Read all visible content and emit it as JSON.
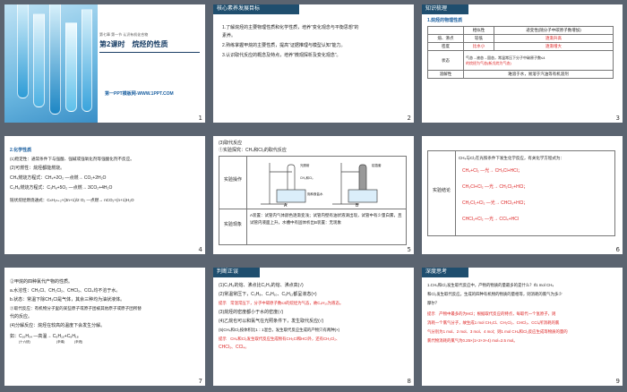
{
  "slide1": {
    "unit_label": "第七章 第一节 认识有机化合物",
    "title": "第2课时　烷烃的性质",
    "site": "第一PPT模板网-WWW.1PPT.COM",
    "page": "1"
  },
  "slide2": {
    "header": "核心素养发展目标",
    "items": [
      "1.了解烷烃的主要物理性质和化学性质，培养“变化观念与平衡思想”的",
      "素养。",
      "2.熟练掌握甲烷的主要性质，提高“证据推理与模型认知”能力。",
      "3.认识取代反应的概念及特点，培养“微观探析及变化观念”。"
    ],
    "page": "2"
  },
  "slide3": {
    "header": "知识梳理",
    "subtitle": "1.烷烃的物理性质",
    "col_header": "相似性",
    "col_trend": "递变性(随分子中碳原子数增加)",
    "rows": [
      [
        "熔、沸点",
        "较低",
        "逐渐升高"
      ],
      [
        "密度",
        "比水小",
        "逐渐增大"
      ],
      [
        "状态",
        "气态→液态→固态，常温常压下分子中碳原子数≤4",
        "的烷烃为气态(新戊烷为气态)"
      ],
      [
        "溶解性",
        "难溶于水，易溶于汽油等有机溶剂",
        ""
      ]
    ],
    "page": "3"
  },
  "slide4": {
    "heading": "2.化学性质",
    "lines": [
      "(1)稳定性：通常条件下与强酸、强碱或强氧化剂等强酸化剂不反应。",
      "(2)可燃性：烷烃都能燃烧。",
      "CH₄燃烧方程式：CH₄+2O₂ —点燃→ CO₂+2H₂O",
      "C₃H₈燃烧方程式：C₃H₈+5O₂ —点燃→ 3CO₂+4H₂O",
      "链状烷烃燃烧通式：CₙH₂ₙ₊₂+(3n+1)/2 O₂ —点燃→ nCO₂+(n+1)H₂O"
    ],
    "page": "4"
  },
  "slide5": {
    "heading": "(3)取代反应",
    "sub": "①实验探究：CH₄和Cl₂的取代反应",
    "row1_label": "实验操作",
    "row2_label": "实验现象",
    "lbl_a": "A",
    "lbl_b": "B",
    "diagram_labels": [
      "光照射",
      "铝箔套",
      "CH₄和Cl₂",
      "饱和食盐水"
    ],
    "result": "A装置：试管内气体颜色逐渐变浅；试管内壁有油状液滴出现，试管中有少量白雾，且试管内液面上升，水槽中有固体析出B装置：无现象",
    "page": "5"
  },
  "slide6": {
    "label": "实验结论",
    "intro": "CH₄与Cl₂在光照条件下发生化学反应，有关化学方程式为：",
    "eqs": [
      "CH₄+Cl₂ —光→ CH₃Cl+HCl；",
      "CH₃Cl+Cl₂ —光→ CH₂Cl₂+HCl；",
      "CH₂Cl₂+Cl₂ —光→ CHCl₃+HCl；",
      "CHCl₃+Cl₂ —光→ CCl₄+HCl"
    ],
    "page": "6"
  },
  "slide7": {
    "lines": [
      "②甲烷的四种氯代产物的性质。",
      "a.水溶性：CH₃Cl、CH₂Cl₂、CHCl₃、CCl₄均不溶于水。",
      "b.状态：常温下除CH₃Cl是气体，其余三种均为油状液体。",
      "③取代反应：有机物分子里的某些原子或原子团被其他原子或原子团所替",
      "代的反应。",
      "(4)分解反应：烷烃在较高的温度下会发生分解。",
      "如：C₁₆H₃₄ —高温→ C₈H₁₆+C₈H₁₈"
    ],
    "sub_labels": [
      "(十六烷)",
      "(辛烯)",
      "(辛烷)"
    ],
    "page": "7"
  },
  "slide8": {
    "header": "判断正误",
    "lines": [
      "(1)C₃H₈的熔、沸点比C₂H₆的熔、沸点高(√)",
      "(2)常温常压下，C₃H₈、C₄H₁₀、C₅H₁₂都呈液态(×)",
      "提示　常温常压下，分子中碳原子数≤4的烷烃为气态，故C₄H₁₀为液态。",
      "(3)烷烃的密度都小于水的密度(√)",
      "(4)乙烷也可以和氯气在光照条件下，发生取代反应(√)",
      "(5)CH₄和Cl₂按体积比1∶1混合，发生取代反应生成的产物只有两种(×)",
      "提示　CH₄和Cl₂发生取代反应生成物有CH₃Cl和HCl外，还有CH₂Cl₂、",
      "CHCl₃、CCl₄。"
    ],
    "page": "8"
  },
  "slide9": {
    "header": "深度思考",
    "lines": [
      "1.CH₄和Cl₂发生取代反应中，产物的物质的量最多的是什么？If1 mol CH₄",
      "和Cl₂发生取代反应，生成的四种有机物的物质的量相等，则消耗的氯气为多少",
      "摩尔？",
      "提示　产物中最多的为HCl；根据取代反应的特点，每取代一个氢原子，则",
      "消耗一个氯气分子，故生成1 mol CH₃Cl、CH₂Cl₂、CHCl₃、CCl₄所消耗的氯",
      "气分别为1 mol、2 mol、3 mol、4 mol；则1 mol CH₄和Cl₂反应生成等物质的量的",
      "氯代物消耗的氯气为0.25×(1+2+3+4) mol=2.5 mol。"
    ],
    "page": "9"
  },
  "colors": {
    "background": "#5b6470",
    "header": "#1f4e6e",
    "accent_red": "#d22222",
    "accent_blue": "#1a5fa0"
  }
}
